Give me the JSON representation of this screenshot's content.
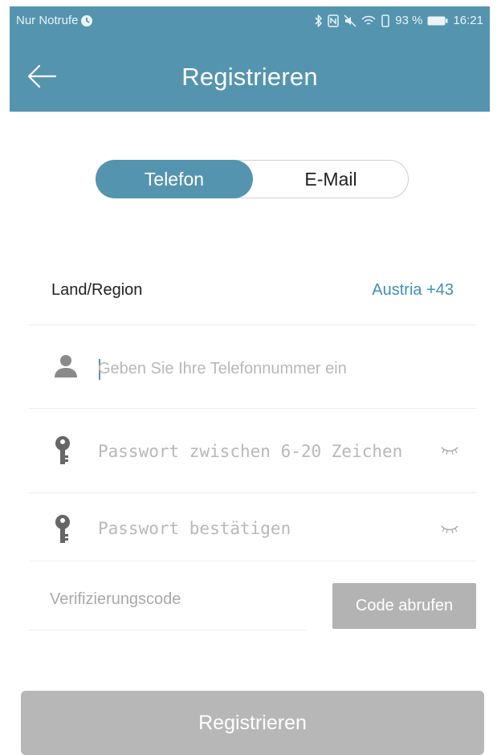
{
  "status_bar": {
    "carrier": "Nur Notrufe",
    "battery_percent": "93 %",
    "time": "16:21",
    "icons": [
      "clock-icon",
      "bluetooth-icon",
      "nfc-icon",
      "mute-icon",
      "wifi-icon",
      "vibrate-icon",
      "battery-icon"
    ]
  },
  "header": {
    "title": "Registrieren",
    "back_icon": "arrow-left-icon",
    "background_color": "#5494ae"
  },
  "tabs": {
    "items": [
      {
        "label": "Telefon",
        "active": true
      },
      {
        "label": "E-Mail",
        "active": false
      }
    ]
  },
  "form": {
    "region_label": "Land/Region",
    "region_value": "Austria +43",
    "phone_placeholder": "Geben Sie Ihre Telefonnummer ein",
    "phone_icon": "user-icon",
    "password_placeholder": "Passwort zwischen 6-20 Zeichen",
    "password_confirm_placeholder": "Passwort bestätigen",
    "password_icon": "key-icon",
    "eye_icon": "eye-closed-icon",
    "verification_placeholder": "Verifizierungscode",
    "get_code_label": "Code abrufen"
  },
  "submit": {
    "label": "Registrieren"
  },
  "colors": {
    "accent": "#5494ae",
    "link": "#3f90b6",
    "disabled": "#b7b7b7"
  }
}
